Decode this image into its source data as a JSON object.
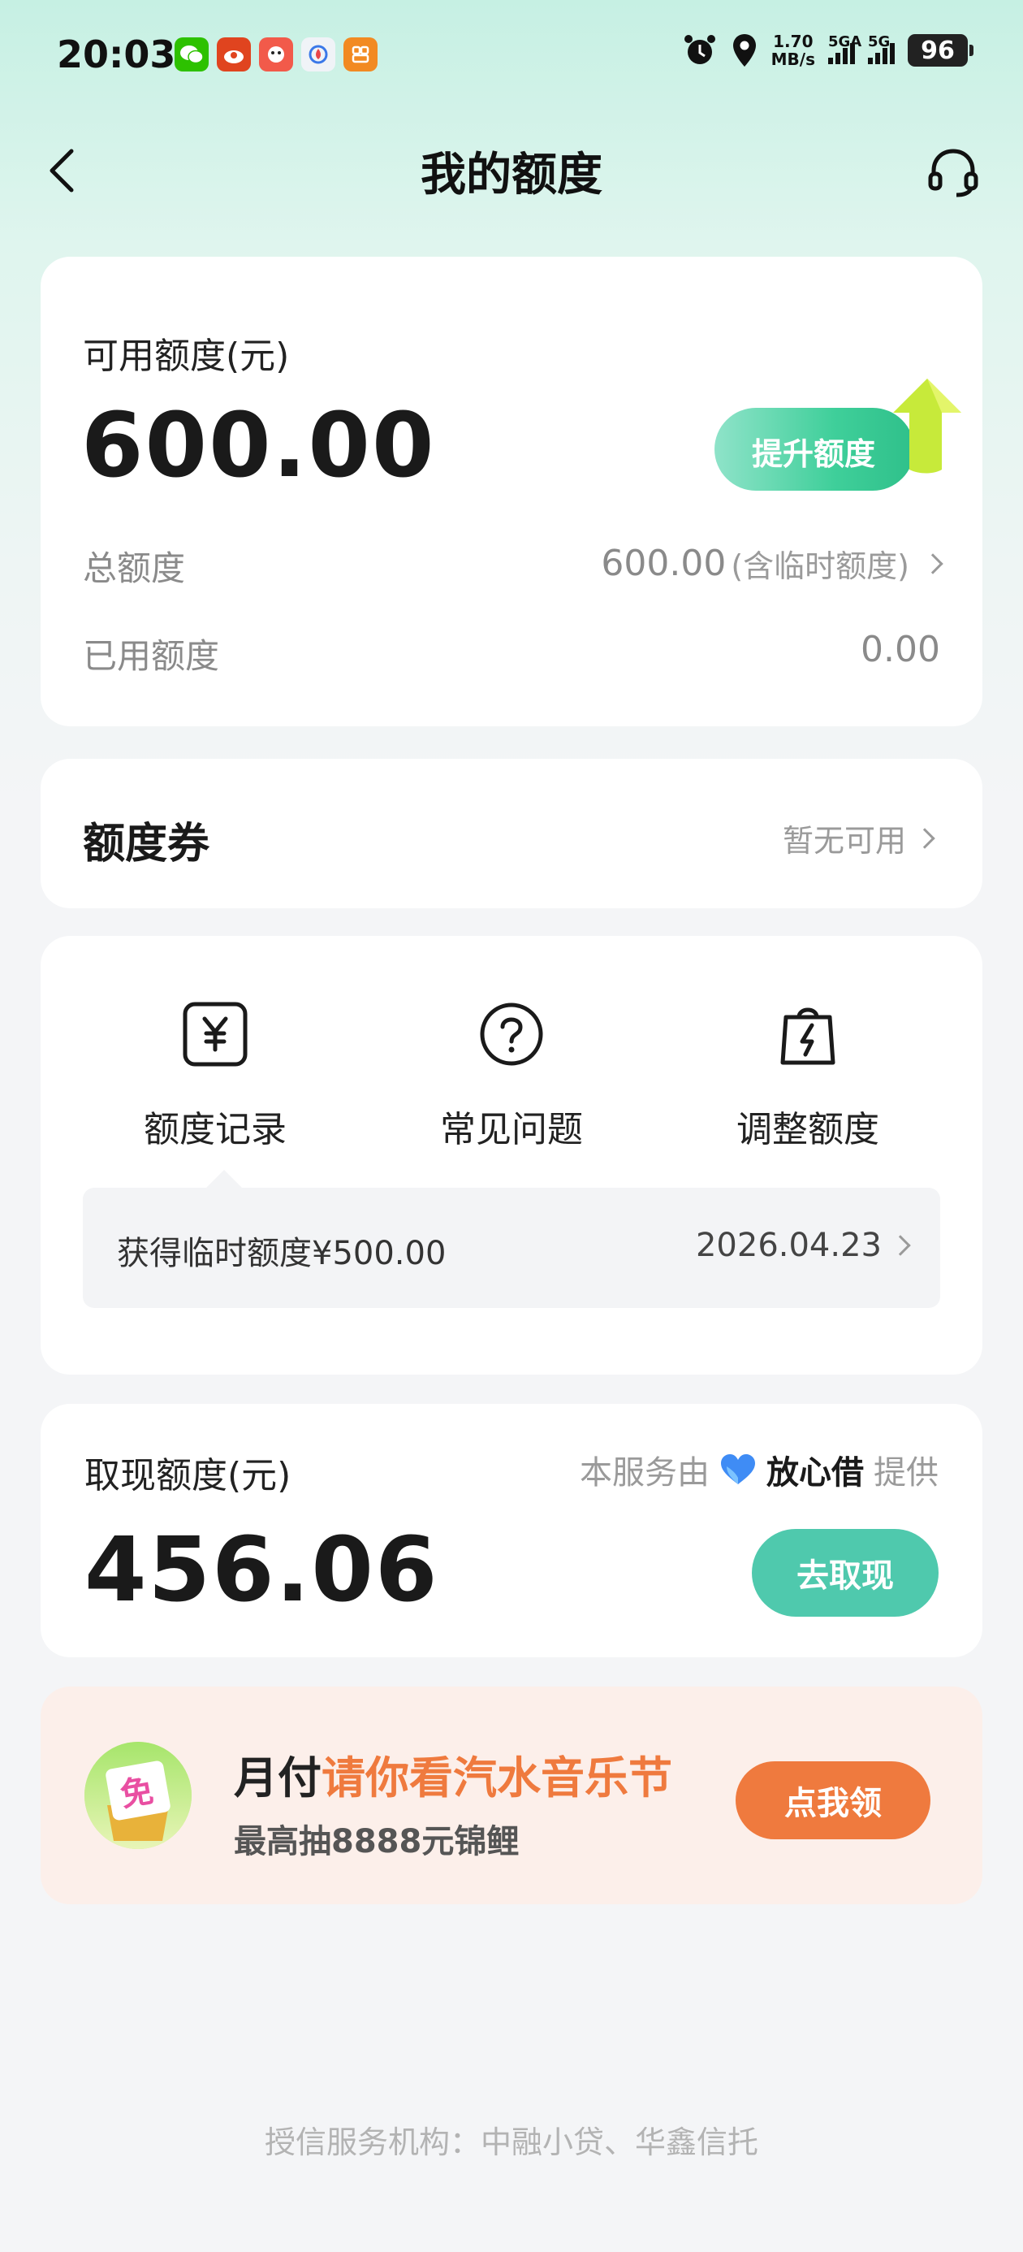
{
  "status_bar": {
    "time": "20:03",
    "speed_value": "1.70",
    "speed_unit": "MB/s",
    "signal1_label": "5GA",
    "signal2_label": "5G",
    "battery": "96",
    "apps": [
      "wechat-icon",
      "app-icon-red-1",
      "app-icon-red-2",
      "app-icon-blue",
      "app-icon-orange"
    ]
  },
  "nav": {
    "title": "我的额度"
  },
  "credit": {
    "available_label": "可用额度(元)",
    "available_amount": "600.00",
    "raise_button": "提升额度",
    "total_label": "总额度",
    "total_value": "600.00",
    "total_note": "(含临时额度)",
    "used_label": "已用额度",
    "used_value": "0.00"
  },
  "coupon": {
    "title": "额度券",
    "status": "暂无可用"
  },
  "quick_actions": [
    {
      "label": "额度记录",
      "icon": "yen-record-icon"
    },
    {
      "label": "常见问题",
      "icon": "question-icon"
    },
    {
      "label": "调整额度",
      "icon": "bag-bolt-icon"
    }
  ],
  "notice": {
    "text": "获得临时额度¥500.00",
    "date": "2026.04.23"
  },
  "cash": {
    "label": "取现额度(元)",
    "provider_prefix": "本服务由",
    "provider_brand": "放心借",
    "provider_suffix": "提供",
    "amount": "456.06",
    "button": "去取现"
  },
  "promo": {
    "title_prefix": "月付",
    "title_highlight": "请你看汽水音乐节",
    "subtitle": "最高抽8888元锦鲤",
    "button": "点我领",
    "badge": "免"
  },
  "footer": "授信服务机构：中融小贷、华鑫信托",
  "colors": {
    "accent_green": "#4fc9ad",
    "accent_orange": "#ef7a3e"
  }
}
